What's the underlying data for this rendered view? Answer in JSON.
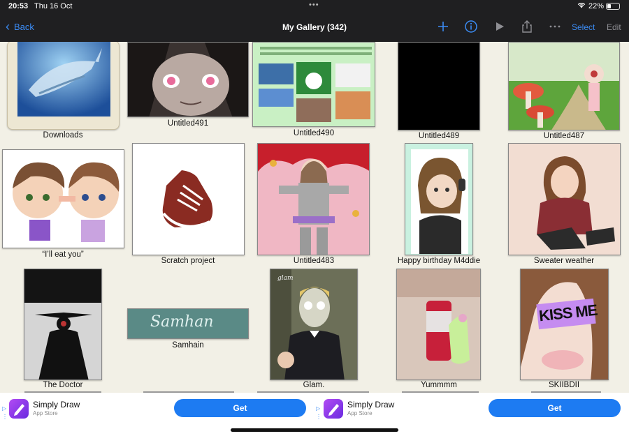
{
  "status": {
    "time": "20:53",
    "date": "Thu 16 Oct",
    "dots": "•••",
    "battery": "22%",
    "battery_level": 0.22
  },
  "nav": {
    "back_label": "Back",
    "title": "My Gallery (342)",
    "select_label": "Select",
    "edit_label": "Edit",
    "accent": "#3b8cf5"
  },
  "gallery": {
    "items": [
      {
        "title": "Downloads",
        "kind": "folder"
      },
      {
        "title": "Untitled491"
      },
      {
        "title": "Untitled490"
      },
      {
        "title": "Untitled489"
      },
      {
        "title": "Untitled487"
      },
      {
        "title": "“I’ll eat you”"
      },
      {
        "title": "Scratch project"
      },
      {
        "title": "Untitled483"
      },
      {
        "title": "Happy birthday M4ddie"
      },
      {
        "title": "Sweater weather"
      },
      {
        "title": "The Doctor"
      },
      {
        "title": "Samhain",
        "artwork_text": "Samhan"
      },
      {
        "title": "Glam.",
        "artwork_text": "glam"
      },
      {
        "title": "Yummmm"
      },
      {
        "title": "SKIIBDII",
        "artwork_text": "KISS ME"
      }
    ]
  },
  "ads": [
    {
      "app": "Simply Draw",
      "store": "App Store",
      "cta": "Get"
    },
    {
      "app": "Simply Draw",
      "store": "App Store",
      "cta": "Get"
    }
  ]
}
